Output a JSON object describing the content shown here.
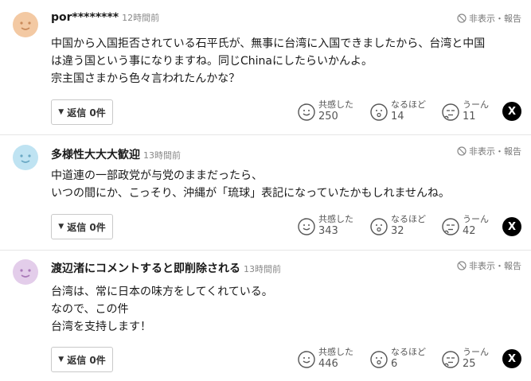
{
  "comments": [
    {
      "author": "por********",
      "time": "12時間前",
      "hide_report": "非表示・報告",
      "lines": [
        "中国から入国拒否されている石平氏が、無事に台湾に入国できましたから、台湾と中国",
        "は違う国という事になりますね。同じChinaにしたらいかんよ。",
        "宗主国さまから色々言われたんかな？"
      ],
      "reply_label": "返信 0件",
      "reactions": [
        {
          "label": "共感した",
          "count": "250"
        },
        {
          "label": "なるほど",
          "count": "14"
        },
        {
          "label": "うーん",
          "count": "11"
        }
      ],
      "share": "X",
      "avatar_color": "#f3c9a3",
      "avatar_face": "#c98a5a"
    },
    {
      "author": "多様性大大大歓迎",
      "time": "13時間前",
      "hide_report": "非表示・報告",
      "lines": [
        "中道連の一部政党が与党のままだったら、",
        "いつの間にか、こっそり、沖縄が「琉球」表記になっていたかもしれませんね。"
      ],
      "reply_label": "返信 0件",
      "reactions": [
        {
          "label": "共感した",
          "count": "343"
        },
        {
          "label": "なるほど",
          "count": "32"
        },
        {
          "label": "うーん",
          "count": "42"
        }
      ],
      "share": "X",
      "avatar_color": "#bfe3f2",
      "avatar_face": "#6aa9c4"
    },
    {
      "author": "渡辺渚にコメントすると即削除される",
      "time": "13時間前",
      "hide_report": "非表示・報告",
      "lines": [
        "台湾は、常に日本の味方をしてくれている。",
        "なので、この件",
        "台湾を支持します！"
      ],
      "reply_label": "返信 0件",
      "reactions": [
        {
          "label": "共感した",
          "count": "446"
        },
        {
          "label": "なるほど",
          "count": "6"
        },
        {
          "label": "うーん",
          "count": "25"
        }
      ],
      "share": "X",
      "avatar_color": "#e3cdea",
      "avatar_face": "#a979b8"
    }
  ]
}
